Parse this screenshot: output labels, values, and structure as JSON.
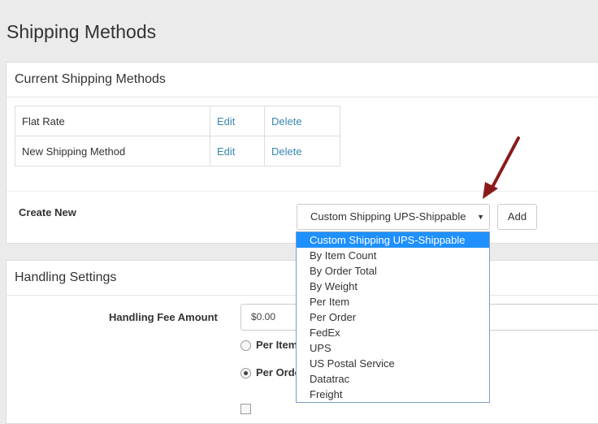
{
  "page": {
    "title": "Shipping Methods"
  },
  "current_methods": {
    "heading": "Current Shipping Methods",
    "rows": [
      {
        "name": "Flat Rate",
        "edit": "Edit",
        "delete": "Delete"
      },
      {
        "name": "New Shipping Method",
        "edit": "Edit",
        "delete": "Delete"
      }
    ],
    "create_label": "Create New",
    "select_value": "Custom Shipping UPS-Shippable",
    "caret": "▼",
    "add_label": "Add"
  },
  "dropdown": {
    "options": [
      "Custom Shipping UPS-Shippable",
      "By Item Count",
      "By Order Total",
      "By Weight",
      "Per Item",
      "Per Order",
      "FedEx",
      "UPS",
      "US Postal Service",
      "Datatrac",
      "Freight"
    ],
    "selected_index": 0
  },
  "handling": {
    "heading": "Handling Settings",
    "fee_label": "Handling Fee Amount",
    "fee_value": "$0.00",
    "radio_per_item": "Per Item",
    "radio_per_order": "Per Order",
    "checked": "per_order"
  },
  "colors": {
    "link": "#3a87ad",
    "selected_option_bg": "#1e90ff",
    "arrow": "#8b1a1a"
  }
}
